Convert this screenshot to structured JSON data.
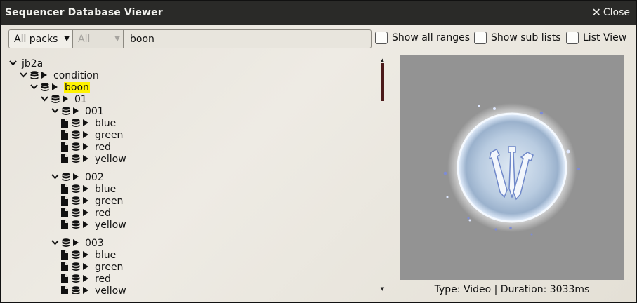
{
  "window": {
    "title": "Sequencer Database Viewer",
    "close_label": "Close"
  },
  "toolbar": {
    "pack_select": "All packs",
    "filter_select": "All",
    "search_value": "boon",
    "show_all_ranges": "Show all ranges",
    "show_sub_lists": "Show sub lists",
    "list_view": "List View"
  },
  "tree": [
    {
      "label": "jb2a",
      "level": 0,
      "type": "root",
      "expanded": true
    },
    {
      "label": "condition",
      "level": 1,
      "type": "folder",
      "expanded": true
    },
    {
      "label": "boon",
      "level": 2,
      "type": "folder",
      "expanded": true,
      "highlight": true
    },
    {
      "label": "01",
      "level": 3,
      "type": "folder",
      "expanded": true
    },
    {
      "label": "001",
      "level": 4,
      "type": "folder",
      "expanded": true
    },
    {
      "label": "blue",
      "level": 5,
      "type": "file"
    },
    {
      "label": "green",
      "level": 5,
      "type": "file"
    },
    {
      "label": "red",
      "level": 5,
      "type": "file"
    },
    {
      "label": "yellow",
      "level": 5,
      "type": "file"
    },
    {
      "label": "002",
      "level": 4,
      "type": "folder",
      "expanded": true,
      "gap": true
    },
    {
      "label": "blue",
      "level": 5,
      "type": "file"
    },
    {
      "label": "green",
      "level": 5,
      "type": "file"
    },
    {
      "label": "red",
      "level": 5,
      "type": "file"
    },
    {
      "label": "yellow",
      "level": 5,
      "type": "file"
    },
    {
      "label": "003",
      "level": 4,
      "type": "folder",
      "expanded": true,
      "gap": true
    },
    {
      "label": "blue",
      "level": 5,
      "type": "file"
    },
    {
      "label": "green",
      "level": 5,
      "type": "file"
    },
    {
      "label": "red",
      "level": 5,
      "type": "file"
    },
    {
      "label": "yellow",
      "level": 5,
      "type": "file"
    }
  ],
  "preview": {
    "caption": "Type: Video | Duration: 3033ms"
  },
  "colors": {
    "highlight": "#fff200",
    "scroll_thumb": "#4b1a1a",
    "preview_bg": "#939393"
  }
}
